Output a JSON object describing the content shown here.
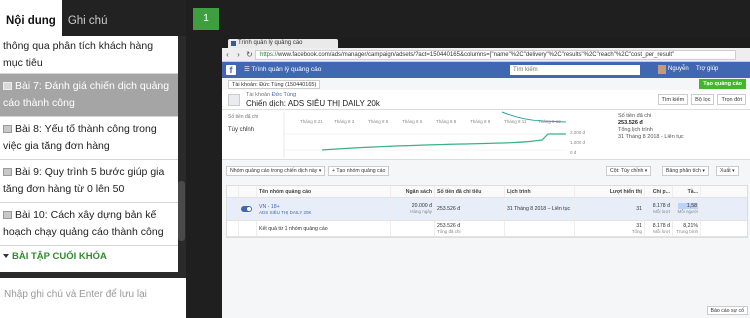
{
  "sidebar": {
    "tabs": [
      "Nội dung",
      "Ghi chú"
    ],
    "lessons": [
      {
        "text": "thông qua phân tích khách hàng mục tiêu",
        "icon": "",
        "active": false
      },
      {
        "text": "Bài 7: Đánh giá chiến dịch quảng cáo thành công",
        "icon": "document-icon",
        "active": true
      },
      {
        "text": "Bài 8: Yếu tố thành công trong việc gia tăng đơn hàng",
        "icon": "document-icon",
        "active": false
      },
      {
        "text": "Bài 9: Quy trình 5 bước giúp gia tăng đơn hàng từ 0 lên 50",
        "icon": "document-icon",
        "active": false
      },
      {
        "text": "Bài 10: Cách xây dựng bản kế hoạch chạy quảng cáo thành công",
        "icon": "document-icon",
        "active": false
      }
    ],
    "section_label": "BÀI TẬP CUỐI KHÓA",
    "note_placeholder": "Nhập ghi chú và Enter để lưu lại"
  },
  "counter": "1",
  "browser": {
    "tab_title": "Trình quản lý quảng cáo",
    "url_https": "https://",
    "url_rest": "www.facebook.com/ads/manager/campaign/adsets/?act=150440165&columns=[\"name\"%2C\"delivery\"%2C\"results\"%2C\"reach\"%2C\"cost_per_result\"",
    "fb": {
      "menu": "☰  Trình quản lý quảng cáo",
      "search_placeholder": "Tìm kiếm",
      "user": "Nguyễn",
      "help": "Trợ giúp",
      "bell": "▾"
    },
    "account_label": "Tài khoản: Đức Tùng (150440165)",
    "create_ad": "Tạo quảng cáo",
    "campaign": {
      "sub_prefix": "Tài khoản",
      "sub_name": "Đức Tùng",
      "title_prefix": "Chiến dịch:",
      "title_name": "ADS SIÊU THỊ DAILY 20k",
      "buttons": [
        "Tìm kiếm",
        "Bộ lọc",
        "Trọn đời"
      ]
    },
    "chart": {
      "x_labels": [
        "Tháng 8 21",
        "Tháng 8 3",
        "Tháng 8 5",
        "Tháng 8 6",
        "Tháng 8 8",
        "Tháng 8 9",
        "Tháng 8 11",
        "Tháng 8 12"
      ],
      "y_labels": [
        "2.000 đ",
        "1.000 đ",
        "0 đ"
      ],
      "side_title": "Tùy chỉnh",
      "side_lines": [
        "Số tiền đã chi",
        "253.526 đ",
        "Tổng lịch trình",
        "31 Tháng 8 2018 - Liên tục"
      ],
      "left_labels": [
        "Số tiền đã chi",
        "Tùy chỉnh"
      ]
    },
    "toolbar": {
      "left": [
        "Nhóm quảng cáo trong chiến dịch này ▾",
        "+ Tạo nhóm quảng cáo"
      ],
      "right": [
        "Cột: Tùy chỉnh ▾",
        "Bảng phân tích ▾",
        "Xuất ▾"
      ]
    },
    "table": {
      "headers": [
        "",
        "",
        "Tên nhóm quảng cáo",
        "Ngân sách",
        "Số tiền đã chi tiêu",
        "Lịch trình",
        "Lượt hiển thị",
        "Chi p...",
        "Tầ..."
      ],
      "row1": {
        "name": "VN - 18+",
        "name_sub": "ADS SIÊU THỊ DAILY 20K",
        "budget": "20.000 đ",
        "budget_sub": "Hàng ngày",
        "spent": "253.526 đ",
        "spent_sub": "",
        "schedule": "31 Tháng 8 2018 – Liên tục",
        "impressions": "31",
        "cost": "8.178 đ",
        "cost_sub": "Mỗi lượt",
        "freq": "1,58",
        "freq_sub": "Mỗi người"
      },
      "row2": {
        "name": "Kết quả từ 1 nhóm quảng cáo",
        "spent": "253.526 đ",
        "spent_sub": "Tổng đã chi",
        "impressions": "31",
        "impressions_sub": "Tổng",
        "cost": "8.178 đ",
        "cost_sub": "Mỗi lượt",
        "freq": "8,21%",
        "freq_sub": "Trung bình"
      }
    },
    "footer_btn": "Báo cáo sự cố"
  }
}
